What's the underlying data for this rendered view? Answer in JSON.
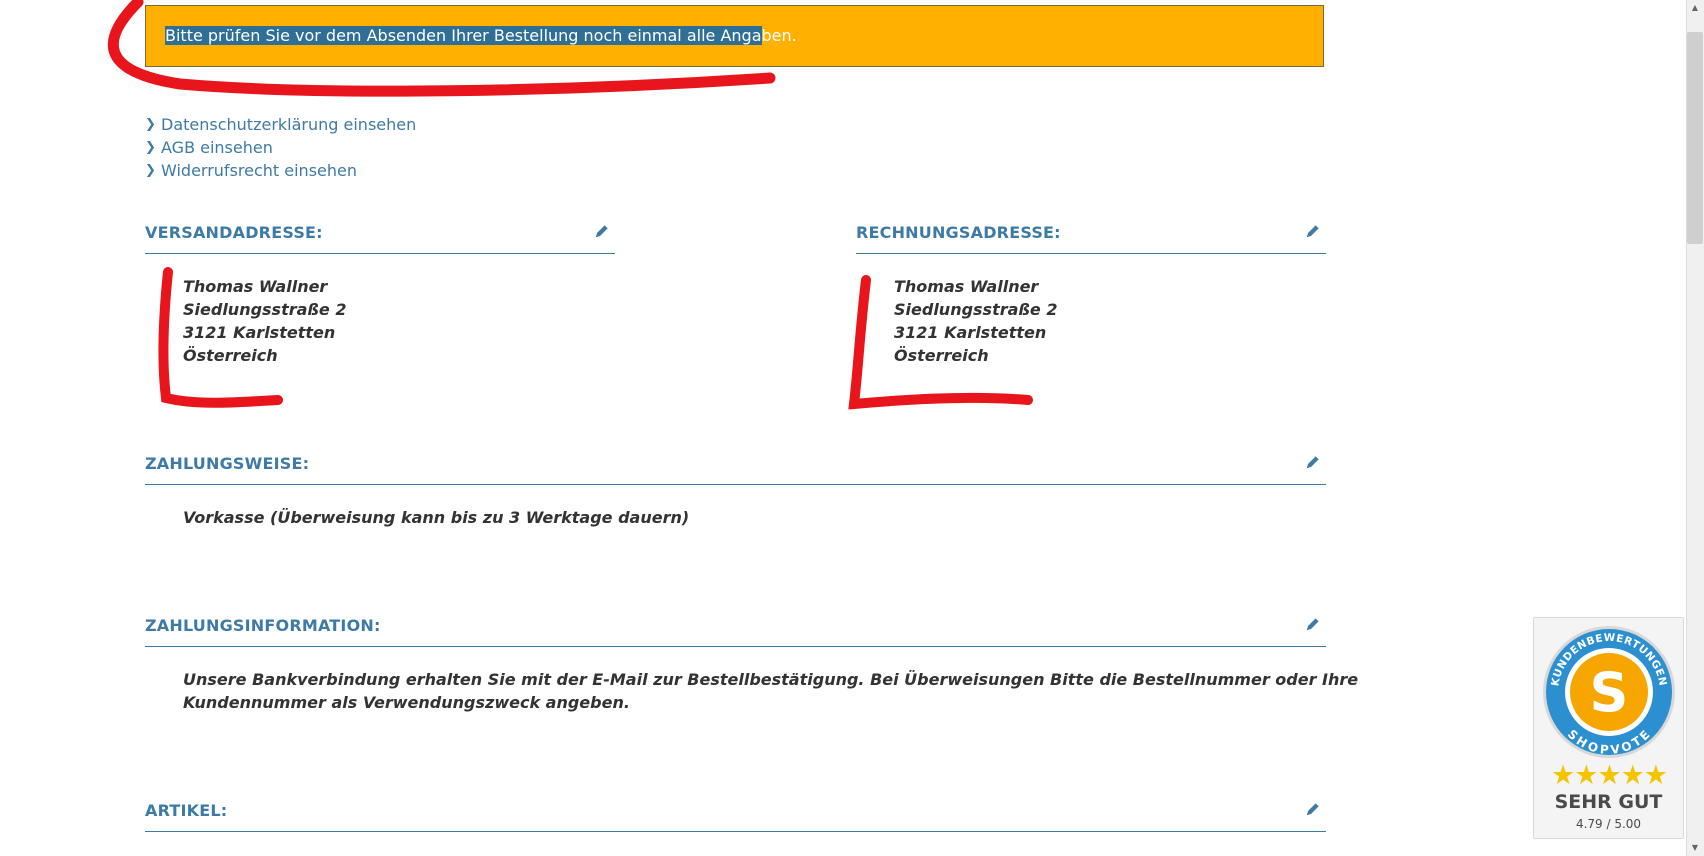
{
  "notice": {
    "text_highlighted": "Bitte prüfen Sie vor dem Absenden Ihrer Bestellung noch einmal alle Anga",
    "text_rest": "ben."
  },
  "links": [
    {
      "label": "Datenschutzerklärung einsehen"
    },
    {
      "label": "AGB einsehen"
    },
    {
      "label": "Widerrufsrecht einsehen"
    }
  ],
  "shipping": {
    "title": "VERSANDADRESSE:",
    "lines": [
      "Thomas Wallner",
      "Siedlungsstraße 2",
      "3121 Karlstetten",
      "Österreich"
    ]
  },
  "billing": {
    "title": "RECHNUNGSADRESSE:",
    "lines": [
      "Thomas Wallner",
      "Siedlungsstraße 2",
      "3121 Karlstetten",
      "Österreich"
    ]
  },
  "payment": {
    "title": "ZAHLUNGSWEISE:",
    "text": "Vorkasse (Überweisung kann bis zu 3 Werktage dauern)"
  },
  "payment_info": {
    "title": "ZAHLUNGSINFORMATION:",
    "line1": "Unsere Bankverbindung erhalten Sie mit der E-Mail zur Bestellbestätigung. Bei Überweisungen Bitte die Bestellnummer oder Ihre",
    "line2": "Kundennummer als Verwendungszweck angeben."
  },
  "articles": {
    "title": "ARTIKEL:"
  },
  "shopvote": {
    "badge_top": "KUNDENBEWERTUNGEN",
    "badge_bottom": "SHOPVOTE",
    "stars": "★★★★★",
    "rating": "SEHR GUT",
    "score": "4.79 / 5.00"
  },
  "colors": {
    "accent": "#3e7aa6",
    "notice_bg": "#ffb000",
    "annotation": "#e8161c"
  },
  "icons": {
    "edit": "pencil-icon",
    "link_bullet": "chevron-right-icon"
  }
}
